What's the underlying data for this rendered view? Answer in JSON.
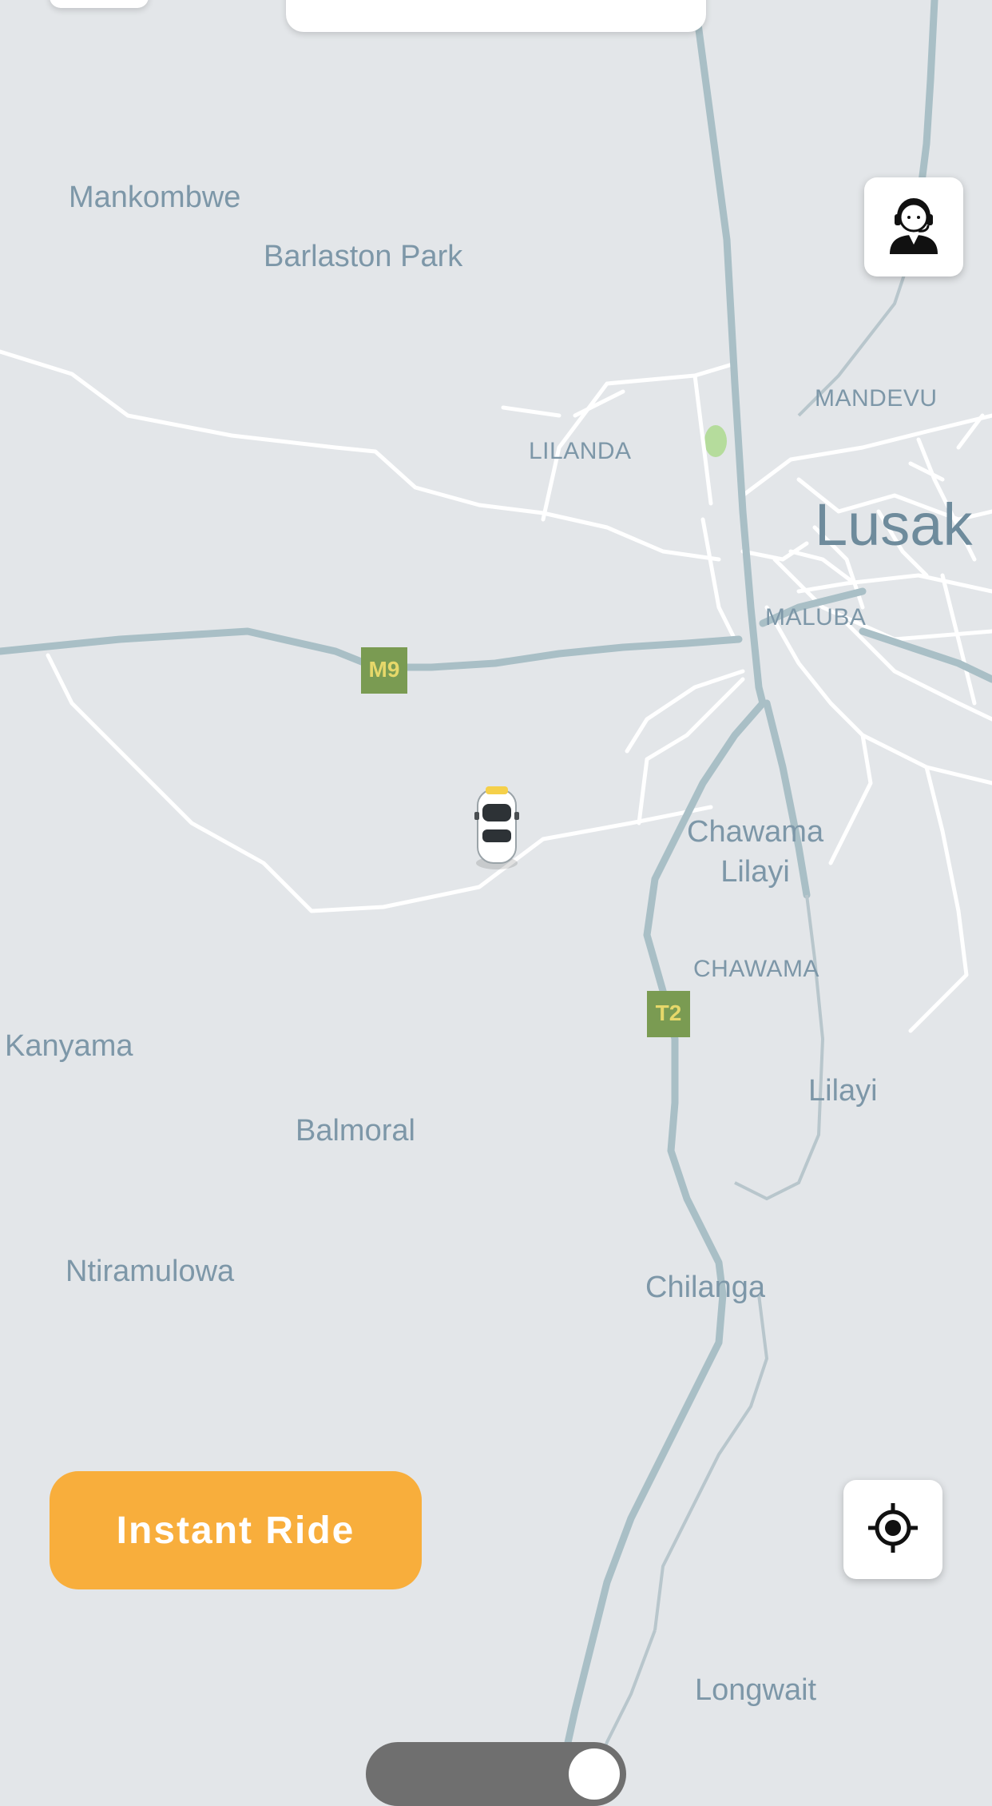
{
  "map": {
    "places": {
      "mankombwe": "Mankombwe",
      "barlaston_park": "Barlaston Park",
      "mandevu": "MANDEVU",
      "lilanda": "LILANDA",
      "lusaka": "Lusak",
      "maluba": "MALUBA",
      "chawama_lilayi": "Chawama\nLilayi",
      "chawama": "CHAWAMA",
      "kanyama": "Kanyama",
      "lilayi": "Lilayi",
      "balmoral": "Balmoral",
      "ntiramulowa": "Ntiramulowa",
      "chilanga": "Chilanga",
      "longwait": "Longwait"
    },
    "road_shields": {
      "m9": "M9",
      "t2": "T2"
    },
    "colors": {
      "background": "#e3e6e9",
      "highway": "#a9bfc6",
      "street": "#ffffff",
      "park": "#b5dc9c",
      "label": "#7d97a8",
      "shield": "#7a9b52"
    }
  },
  "controls": {
    "support_icon": "support-agent-icon",
    "locate_icon": "my-location-icon",
    "car_icon": "car-marker-icon"
  },
  "primary_action": {
    "label": "Instant Ride",
    "color": "#f8ae3c"
  }
}
